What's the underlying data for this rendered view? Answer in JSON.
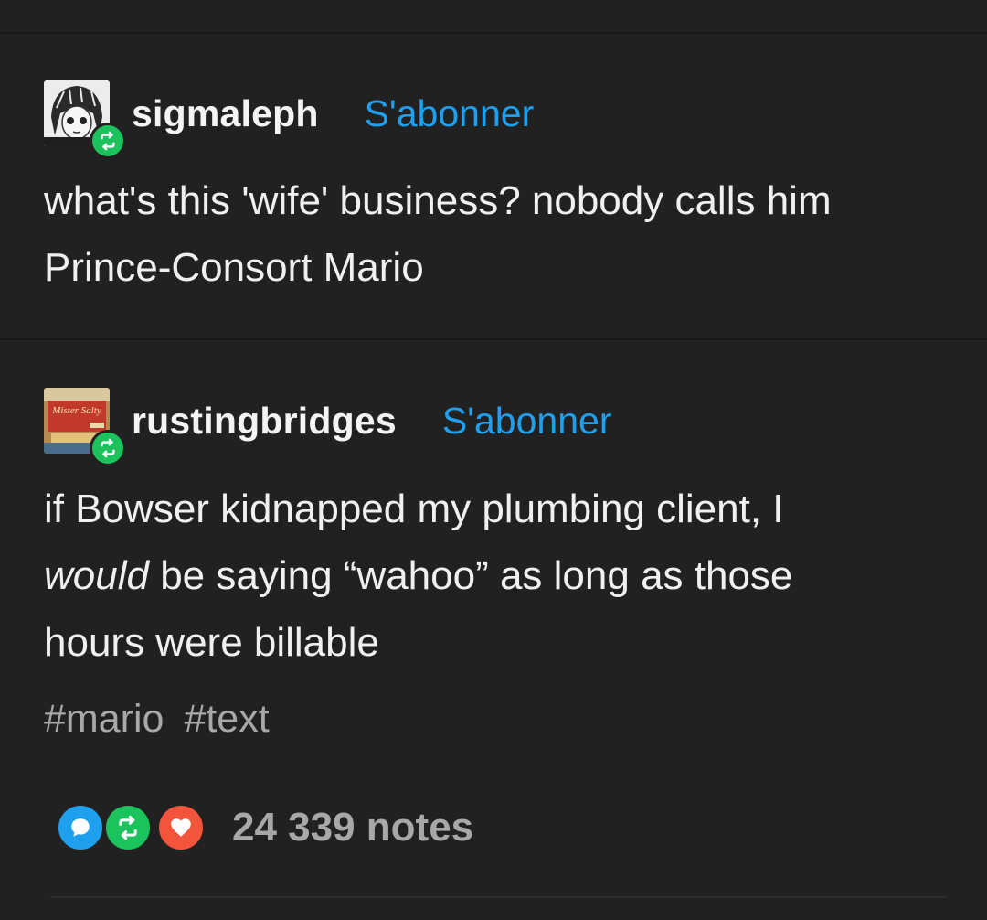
{
  "posts": [
    {
      "username": "sigmaleph",
      "follow_label": "S'abonner",
      "avatar_icon": "manga-portrait-avatar",
      "text_lines": [
        "what's this 'wife' business? nobody calls him",
        "Prince-Consort Mario"
      ]
    },
    {
      "username": "rustingbridges",
      "follow_label": "S'abonner",
      "avatar_icon": "mister-salty-box-avatar",
      "avatar_text": "Mister Salty",
      "text_line1": "if Bowser kidnapped my plumbing client, I",
      "text_line2_em": "would",
      "text_line2_rest": " be saying “wahoo” as long as those",
      "text_line3": "hours were billable"
    }
  ],
  "tags": [
    "#mario",
    "#text"
  ],
  "notes": {
    "count_label": "24 339 notes",
    "icons": [
      "reply-icon",
      "reblog-icon",
      "like-icon"
    ]
  },
  "colors": {
    "background": "#212121",
    "accent_blue": "#1ea0ee",
    "reblog_green": "#1cc35c",
    "like_red": "#f2553c",
    "muted_text": "#a8a8a8"
  }
}
